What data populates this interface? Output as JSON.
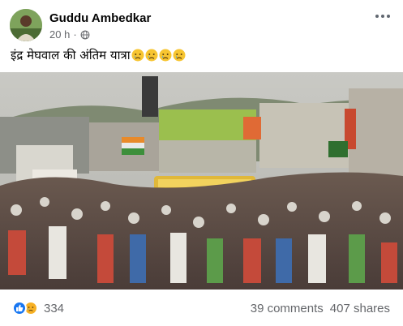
{
  "post": {
    "author": "Guddu Ambedkar",
    "time": "20 h",
    "separator": "·",
    "privacy_icon": "globe-icon",
    "caption_text": "इंद्र मेघवाल की अंतिम यात्रा",
    "caption_emojis": [
      "crying-face",
      "crying-face",
      "crying-face",
      "crying-face"
    ]
  },
  "reactions": {
    "icons": [
      "like-icon",
      "sad-reaction-icon"
    ],
    "count": "334",
    "comments": "39 comments",
    "shares": "407 shares"
  },
  "colors": {
    "like": "#1877f2",
    "sad": "#f7b125",
    "meta_text": "#65676b"
  }
}
